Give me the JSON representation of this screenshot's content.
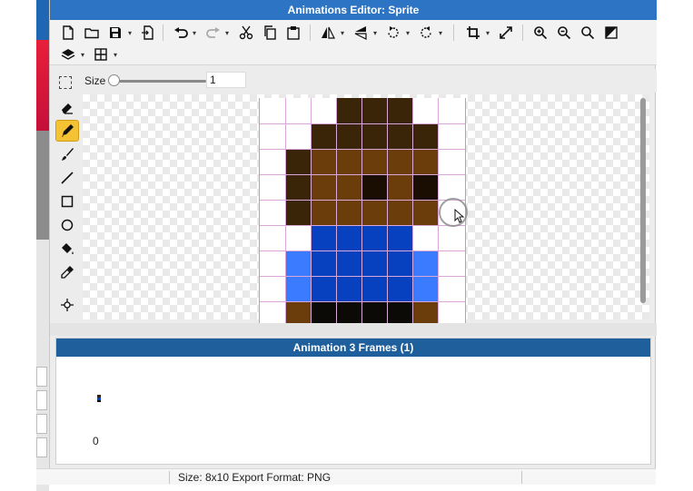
{
  "window": {
    "title": "Animations Editor: Sprite"
  },
  "toolbar": {
    "icons": [
      "new-file-icon",
      "open-folder-icon",
      "save-icon",
      "export-icon",
      "undo-icon",
      "redo-icon",
      "cut-icon",
      "copy-icon",
      "paste-icon",
      "flip-horizontal-icon",
      "flip-vertical-icon",
      "rotate-left-icon",
      "rotate-right-icon",
      "crop-icon",
      "resize-icon",
      "zoom-in-icon",
      "zoom-out-icon",
      "zoom-fit-icon",
      "invert-icon",
      "layers-icon",
      "grid-icon"
    ]
  },
  "options": {
    "size_label": "Size",
    "size_value": "1",
    "size_level": 0.0
  },
  "tools": [
    "marquee-select-icon",
    "eraser-icon",
    "pencil-icon",
    "brush-icon",
    "line-icon",
    "rectangle-icon",
    "ellipse-icon",
    "fill-bucket-icon",
    "eyedropper-icon",
    "move-icon"
  ],
  "active_tool": "pencil",
  "sprite": {
    "palette": {
      "W": "#ffffff",
      "D": "#3b2509",
      "B": "#6b3d0a",
      "K": "#1a0e03",
      "U": "#0841c0",
      "L": "#3a7bff",
      "N": "#0c0a06",
      "T": ""
    },
    "rows": [
      "WWWDDDWW",
      "WWDDDDDW",
      "WDBBBBBW",
      "WDBBKBKW",
      "WDBBBBBW",
      "WWUUUUWW",
      "WLUUUULW",
      "WLUUUULW",
      "WBNNNNBW"
    ]
  },
  "animation": {
    "header": "Animation 3 Frames (1)",
    "frame_index": "0"
  },
  "status": {
    "text": "Size: 8x10   Export Format: PNG"
  }
}
